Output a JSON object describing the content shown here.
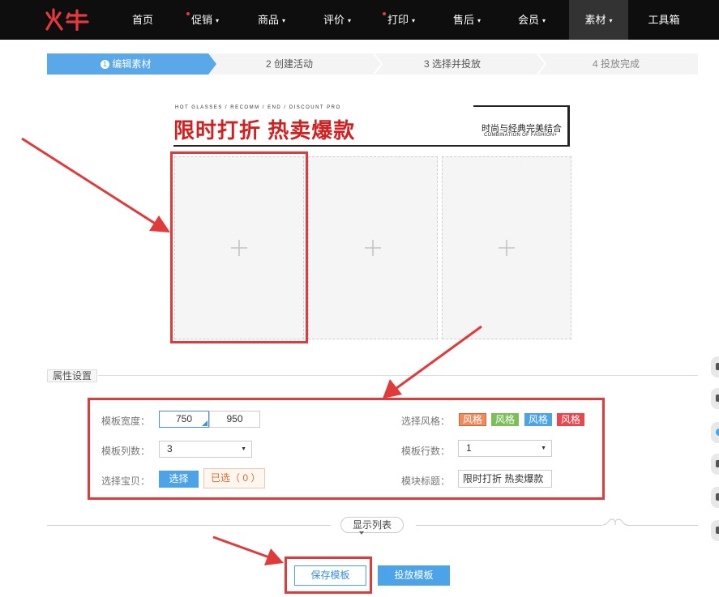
{
  "nav": {
    "logo": "火牛",
    "items": [
      {
        "label": "首页",
        "dot": false,
        "caret": false
      },
      {
        "label": "促销",
        "dot": true,
        "caret": true
      },
      {
        "label": "商品",
        "dot": false,
        "caret": true
      },
      {
        "label": "评价",
        "dot": false,
        "caret": true
      },
      {
        "label": "打印",
        "dot": true,
        "caret": true
      },
      {
        "label": "售后",
        "dot": false,
        "caret": true
      },
      {
        "label": "会员",
        "dot": false,
        "caret": true
      },
      {
        "label": "素材",
        "dot": false,
        "caret": true,
        "active": true
      },
      {
        "label": "工具箱",
        "dot": false,
        "caret": false
      }
    ],
    "caret_glyph": "▾"
  },
  "steps": {
    "step1": {
      "num": "1",
      "label": "编辑素材"
    },
    "step2": "2  创建活动",
    "step3": "3  选择并投放",
    "step4": "4  投放完成"
  },
  "banner": {
    "small_text": "HOT GLASSES / RECOMM / END / DISCOUNT PRO",
    "title": "限时打折 热卖爆款",
    "right_cn": "时尚与经典完美结合",
    "right_en": "COMBINATION OF FASHION+"
  },
  "attributes": {
    "section_label": "属性设置",
    "width_label": "模板宽度：",
    "width_options": [
      "750",
      "950"
    ],
    "columns_label": "模板列数：",
    "columns_value": "3",
    "pick_label": "选择宝贝：",
    "pick_button": "选择",
    "selected_text": "已选（ 0 ）",
    "style_label": "选择风格：",
    "style_chips": [
      {
        "label": "风格",
        "color": "#f08b5e"
      },
      {
        "label": "风格",
        "color": "#7cbf5a"
      },
      {
        "label": "风格",
        "color": "#4da3e8"
      },
      {
        "label": "风格",
        "color": "#e8474f"
      }
    ],
    "rows_label": "模板行数：",
    "rows_value": "1",
    "title_label": "模块标题：",
    "title_value": "限时打折 热卖爆款"
  },
  "show_list": "显示列表",
  "buttons": {
    "save": "保存模板",
    "launch": "投放模板"
  },
  "colors": {
    "accent": "#4da3e8",
    "annotation_red": "#e03a3a",
    "nav_bg": "#0e0e0e"
  }
}
